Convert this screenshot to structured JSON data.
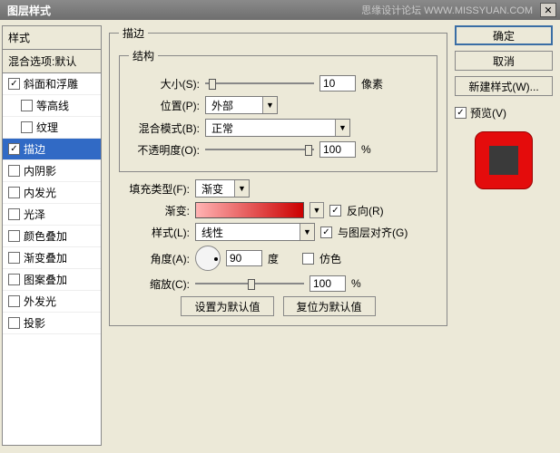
{
  "window": {
    "title": "图层样式",
    "watermark": "思缘设计论坛  WWW.MISSYUAN.COM"
  },
  "sidebar": {
    "header": "样式",
    "blend": "混合选项:默认",
    "items": [
      {
        "label": "斜面和浮雕",
        "checked": true,
        "sub": false
      },
      {
        "label": "等高线",
        "checked": false,
        "sub": true
      },
      {
        "label": "纹理",
        "checked": false,
        "sub": true
      },
      {
        "label": "描边",
        "checked": true,
        "sub": false,
        "selected": true
      },
      {
        "label": "内阴影",
        "checked": false,
        "sub": false
      },
      {
        "label": "内发光",
        "checked": false,
        "sub": false
      },
      {
        "label": "光泽",
        "checked": false,
        "sub": false
      },
      {
        "label": "颜色叠加",
        "checked": false,
        "sub": false
      },
      {
        "label": "渐变叠加",
        "checked": false,
        "sub": false
      },
      {
        "label": "图案叠加",
        "checked": false,
        "sub": false
      },
      {
        "label": "外发光",
        "checked": false,
        "sub": false
      },
      {
        "label": "投影",
        "checked": false,
        "sub": false
      }
    ]
  },
  "stroke": {
    "legend": "描边",
    "structure_legend": "结构",
    "size_label": "大小(S):",
    "size_value": "10",
    "size_unit": "像素",
    "position_label": "位置(P):",
    "position_value": "外部",
    "blend_label": "混合模式(B):",
    "blend_value": "正常",
    "opacity_label": "不透明度(O):",
    "opacity_value": "100",
    "opacity_unit": "%",
    "filltype_label": "填充类型(F):",
    "filltype_value": "渐变",
    "gradient_label": "渐变:",
    "reverse_label": "反向(R)",
    "style_label": "样式(L):",
    "style_value": "线性",
    "align_label": "与图层对齐(G)",
    "angle_label": "角度(A):",
    "angle_value": "90",
    "angle_unit": "度",
    "dither_label": "仿色",
    "scale_label": "缩放(C):",
    "scale_value": "100",
    "scale_unit": "%",
    "set_default": "设置为默认值",
    "reset_default": "复位为默认值"
  },
  "buttons": {
    "ok": "确定",
    "cancel": "取消",
    "newstyle": "新建样式(W)...",
    "preview": "预览(V)"
  }
}
